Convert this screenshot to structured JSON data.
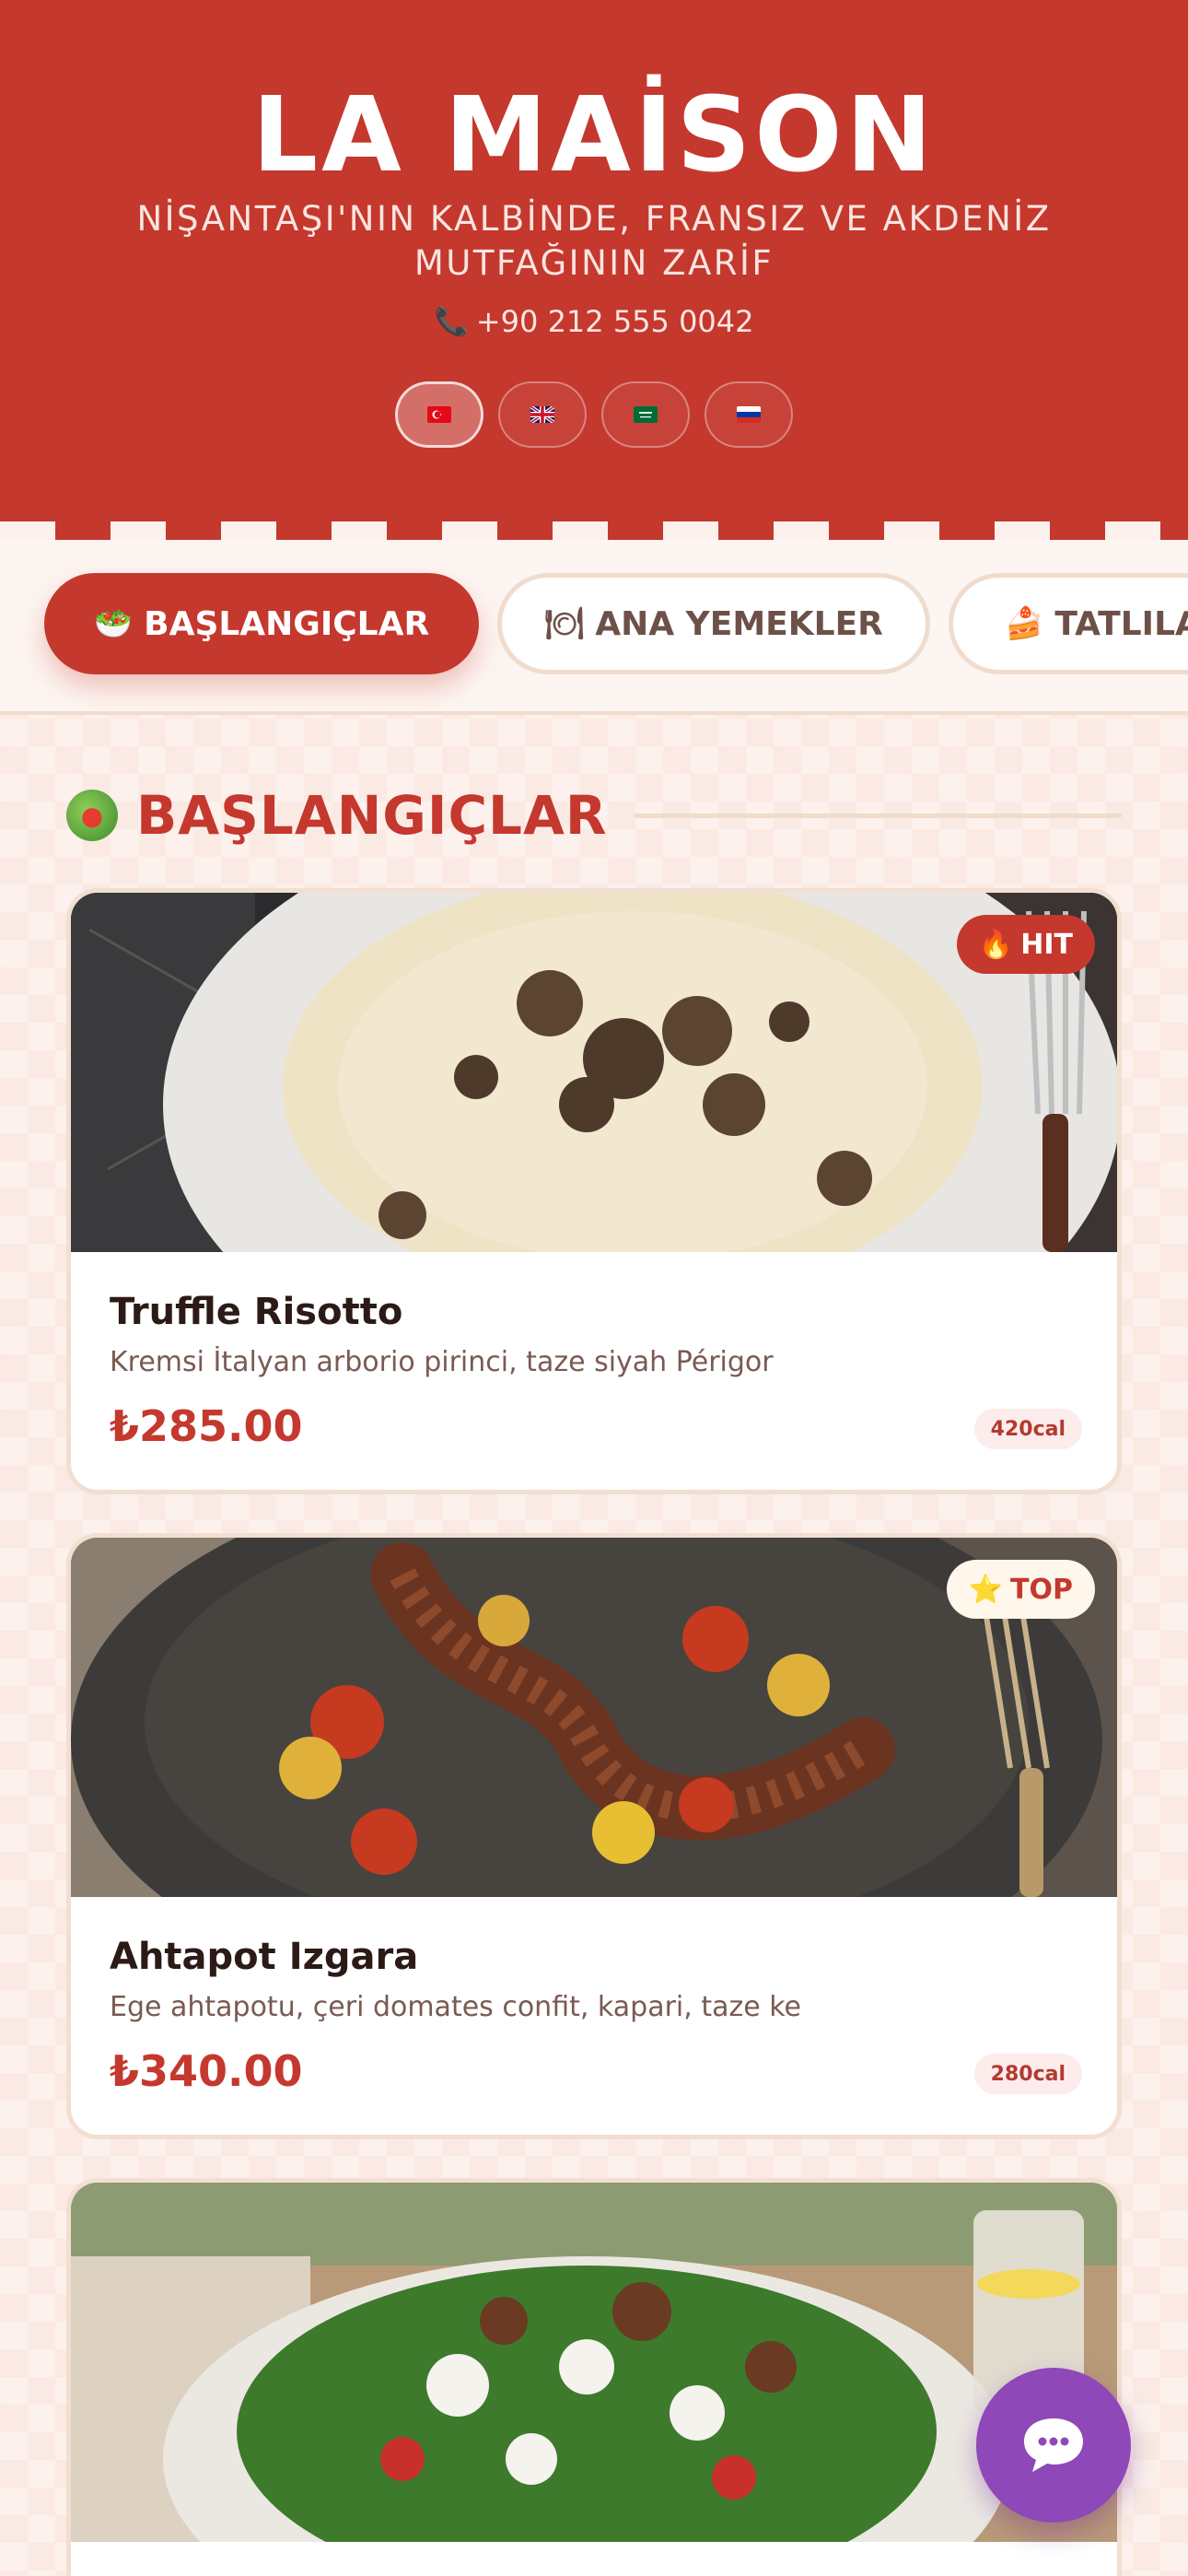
{
  "header": {
    "brand": "LA MAİSON",
    "tagline": "NİŞANTAŞI'NIN KALBİNDE, FRANSIZ VE AKDENİZ MUTFAĞININ ZARİF",
    "phone_icon": "phone-icon",
    "phone": "+90 212 555 0042",
    "languages": [
      {
        "code": "tr",
        "flag": "turkey-flag",
        "active": true
      },
      {
        "code": "en",
        "flag": "uk-flag",
        "active": false
      },
      {
        "code": "ar",
        "flag": "saudi-flag",
        "active": false
      },
      {
        "code": "ru",
        "flag": "russia-flag",
        "active": false
      }
    ]
  },
  "tabs": [
    {
      "icon": "salad-icon",
      "label": "BAŞLANGIÇLAR",
      "active": true
    },
    {
      "icon": "plate-icon",
      "label": "ANA YEMEKLER",
      "active": false
    },
    {
      "icon": "cake-icon",
      "label": "TATLILA",
      "active": false
    }
  ],
  "section": {
    "icon": "salad-icon",
    "title": "BAŞLANGIÇLAR"
  },
  "items": [
    {
      "badge": "HIT",
      "badge_icon": "fire-icon",
      "name": "Truffle Risotto",
      "description": "Kremsi İtalyan arborio pirinci, taze siyah Périgor",
      "price": "₺285.00",
      "calories": "420cal"
    },
    {
      "badge": "TOP",
      "badge_icon": "star-icon",
      "name": "Ahtapot Izgara",
      "description": "Ege ahtapotu, çeri domates confit, kapari, taze ke",
      "price": "₺340.00",
      "calories": "280cal"
    },
    {
      "image": "salad-photo"
    }
  ],
  "chat_button": {
    "icon": "chat-bubble-icon"
  },
  "colors": {
    "primary": "#c4382e",
    "background": "#fcf1ec",
    "border": "#f2dfd1",
    "chat": "#8e48b8"
  }
}
